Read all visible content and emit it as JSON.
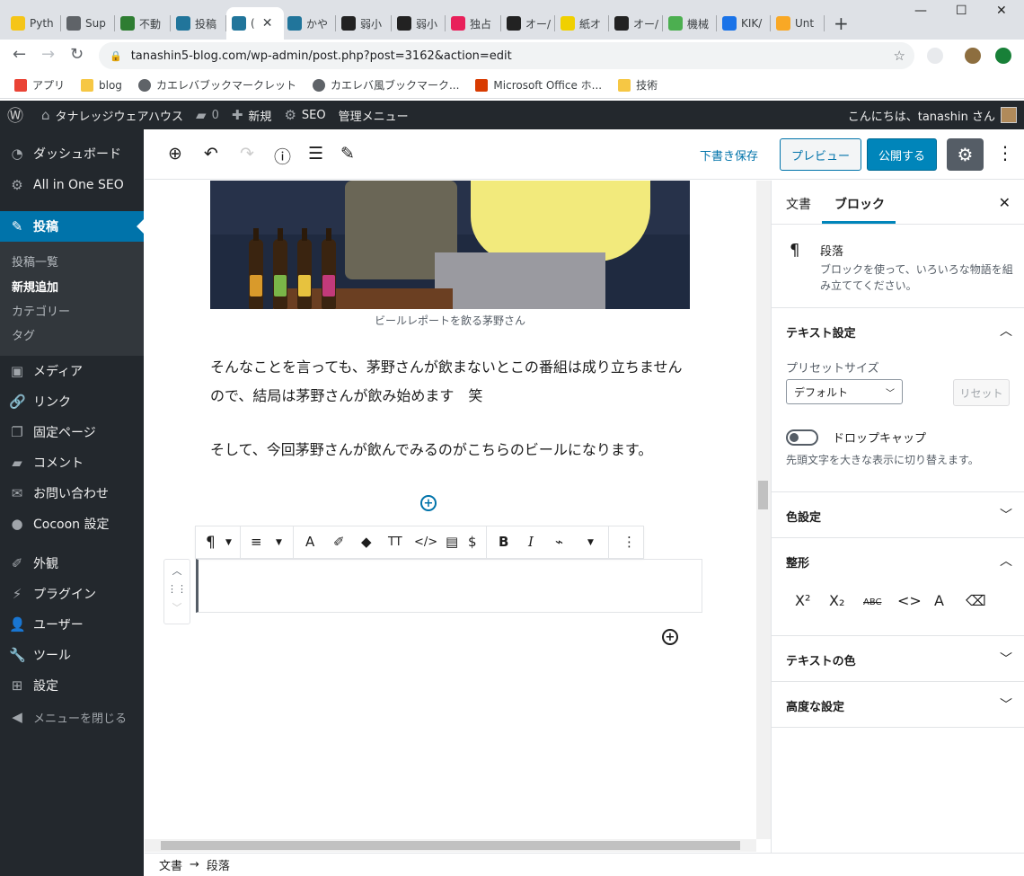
{
  "browser": {
    "tabs": [
      {
        "label": "Pyth",
        "color": "#f5c518"
      },
      {
        "label": "Sup",
        "color": "#5f6368"
      },
      {
        "label": "不動",
        "color": "#2e7d32"
      },
      {
        "label": "投稿",
        "color": "#21759b"
      },
      {
        "label": "(",
        "color": "#21759b"
      },
      {
        "label": "かや",
        "color": "#21759b"
      },
      {
        "label": "弱小",
        "color": "#222222"
      },
      {
        "label": "弱小",
        "color": "#222222"
      },
      {
        "label": "独占",
        "color": "#e8205a"
      },
      {
        "label": "オー/",
        "color": "#222222"
      },
      {
        "label": "紙オ",
        "color": "#f0d000"
      },
      {
        "label": "オー/",
        "color": "#222222"
      },
      {
        "label": "機械",
        "color": "#4caf50"
      },
      {
        "label": "KIK/",
        "color": "#1a73e8"
      },
      {
        "label": "Unt",
        "color": "#f9a825"
      }
    ],
    "active_tab_close": "✕",
    "new_tab": "+",
    "window_controls": [
      "—",
      "☐",
      "✕"
    ],
    "address": "tanashin5-blog.com/wp-admin/post.php?post=3162&action=edit",
    "bookmarks": [
      {
        "label": "アプリ",
        "color": "#ea4335"
      },
      {
        "label": "blog",
        "color": "#f6c744"
      },
      {
        "label": "カエレバブックマークレット",
        "color": "#5f6368"
      },
      {
        "label": "カエレバ風ブックマーク...",
        "color": "#5f6368"
      },
      {
        "label": "Microsoft Office ホ...",
        "color": "#d83b01"
      },
      {
        "label": "技術",
        "color": "#f6c744"
      }
    ]
  },
  "adminbar": {
    "site_name": "タナレッジウェアハウス",
    "comments_count": "0",
    "new_label": "新規",
    "seo_label": "SEO",
    "admin_menu_label": "管理メニュー",
    "greeting": "こんにちは、tanashin さん"
  },
  "sidemenu": {
    "items": [
      {
        "label": "ダッシュボード",
        "icon": "dashboard-icon",
        "glyph": "◔"
      },
      {
        "label": "All in One SEO",
        "icon": "seo-gear-icon",
        "glyph": "⚙"
      },
      {
        "label": "投稿",
        "icon": "pin-icon",
        "glyph": "✎"
      },
      {
        "label": "メディア",
        "icon": "media-icon",
        "glyph": "▣"
      },
      {
        "label": "リンク",
        "icon": "link-icon",
        "glyph": "🔗"
      },
      {
        "label": "固定ページ",
        "icon": "pages-icon",
        "glyph": "❐"
      },
      {
        "label": "コメント",
        "icon": "comment-icon",
        "glyph": "▰"
      },
      {
        "label": "お問い合わせ",
        "icon": "mail-icon",
        "glyph": "✉"
      },
      {
        "label": "Cocoon 設定",
        "icon": "cocoon-icon",
        "glyph": "●"
      },
      {
        "label": "外観",
        "icon": "appearance-icon",
        "glyph": "✐"
      },
      {
        "label": "プラグイン",
        "icon": "plugin-icon",
        "glyph": "⚡"
      },
      {
        "label": "ユーザー",
        "icon": "user-icon",
        "glyph": "👤"
      },
      {
        "label": "ツール",
        "icon": "tools-icon",
        "glyph": "🔧"
      },
      {
        "label": "設定",
        "icon": "settings-icon",
        "glyph": "⊞"
      },
      {
        "label": "メニューを閉じる",
        "icon": "collapse-icon",
        "glyph": "◀"
      }
    ],
    "submenu": [
      "投稿一覧",
      "新規追加",
      "カテゴリー",
      "タグ"
    ]
  },
  "editor": {
    "save_draft": "下書き保存",
    "preview": "プレビュー",
    "publish": "公開する",
    "caption": "ビールレポートを飲る茅野さん",
    "paragraphs": [
      "そんなことを言っても、茅野さんが飲まないとこの番組は成り立ちませんので、結局は茅野さんが飲み始めます　笑",
      "そして、今回茅野さんが飲んでみるのがこちらのビールになります。"
    ],
    "breadcrumb_root": "文書",
    "breadcrumb_arrow": "→",
    "breadcrumb_leaf": "段落"
  },
  "sidebar": {
    "tab_document": "文書",
    "tab_block": "ブロック",
    "block_name": "段落",
    "block_description": "ブロックを使って、いろいろな物語を組み立ててください。",
    "text_settings": "テキスト設定",
    "preset_size_label": "プリセットサイズ",
    "preset_size_value": "デフォルト",
    "reset": "リセット",
    "drop_cap": "ドロップキャップ",
    "drop_cap_help": "先頭文字を大きな表示に切り替えます。",
    "color_settings": "色設定",
    "formatting": "整形",
    "text_color": "テキストの色",
    "advanced": "高度な設定"
  },
  "colors": {
    "wp_dark": "#23282d",
    "wp_blue": "#0073aa",
    "publish_blue": "#0085ba"
  }
}
